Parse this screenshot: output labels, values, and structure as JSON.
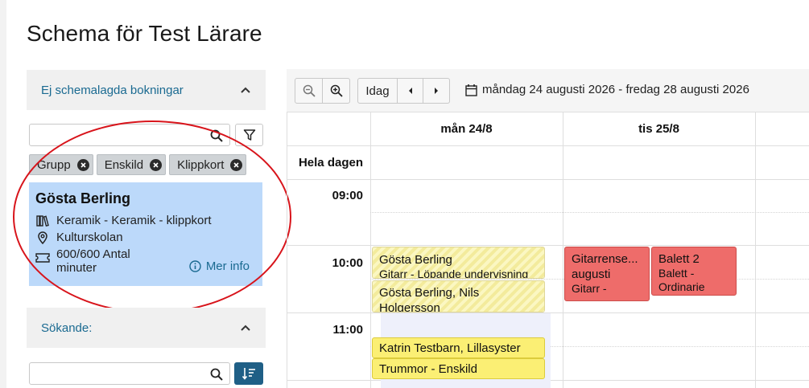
{
  "page": {
    "title": "Schema för Test Lärare"
  },
  "unscheduled": {
    "header": "Ej schemalagda bokningar",
    "search_placeholder": "",
    "chips": [
      {
        "label": "Grupp"
      },
      {
        "label": "Enskild"
      },
      {
        "label": "Klippkort"
      }
    ],
    "booking": {
      "name": "Gösta Berling",
      "course": "Keramik - Keramik - klippkort",
      "location": "Kulturskolan",
      "minutes": "600/600 Antal minuter",
      "more_info": "Mer info"
    }
  },
  "applicants": {
    "header": "Sökande:",
    "search_placeholder": ""
  },
  "calendar": {
    "today_label": "Idag",
    "date_range": "måndag 24 augusti 2026 - fredag 28 augusti 2026",
    "days": [
      "mån 24/8",
      "tis 25/8"
    ],
    "all_day_label": "Hela dagen",
    "times": [
      "09:00",
      "10:00",
      "11:00"
    ],
    "events": [
      {
        "title": "Gösta Berling",
        "subtitle": "Gitarr - Löpande undervisning",
        "style": "striped"
      },
      {
        "title": "Gösta Berling, Nils Holgersson",
        "subtitle": "",
        "style": "striped"
      },
      {
        "title": "Katrin Testbarn, Lillasyster",
        "subtitle": "",
        "style": "yellow"
      },
      {
        "title": "Trummor - Enskild",
        "subtitle": "",
        "style": "yellow"
      },
      {
        "title": "Gitarrense...",
        "subtitle": "augusti",
        "extra": "Gitarr -",
        "style": "red"
      },
      {
        "title": "Balett 2",
        "subtitle": "Balett -",
        "extra": "Ordinarie",
        "style": "red"
      }
    ]
  },
  "colors": {
    "accent": "#1a6a91",
    "booking_bg": "#bcd9fa",
    "event_red": "#ee6c6a",
    "event_yellow": "#fbef74",
    "highlight": "#d8141b"
  }
}
